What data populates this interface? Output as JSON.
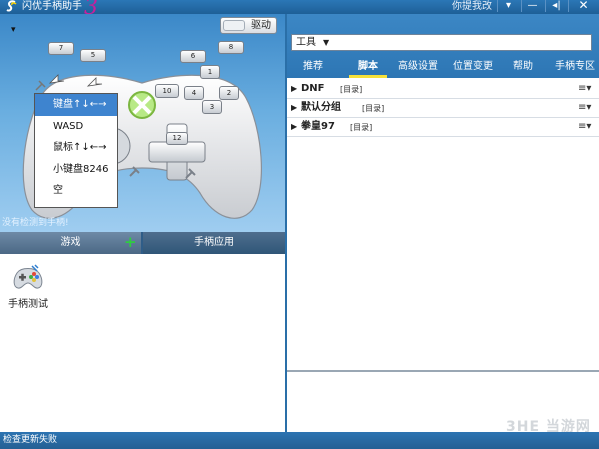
{
  "window": {
    "title": "闪优手柄助手",
    "version_mark": "3",
    "feedback_link": "你提我改",
    "controls": {
      "menu": "▾",
      "minimize": "—",
      "sound": "◂|",
      "close": "✕"
    }
  },
  "left_panel": {
    "menu_arrow": "▾",
    "drive_button": "驱动",
    "status_message": "没有检测到手柄!",
    "button_labels": [
      "7",
      "5",
      "6",
      "8",
      "1",
      "4",
      "2",
      "3",
      "10",
      "12"
    ],
    "key_mode_menu": {
      "selected": "键盘↑↓←→",
      "options": [
        "键盘↑↓←→",
        "WASD",
        "鼠标↑↓←→",
        "小键盘8246",
        "空"
      ]
    },
    "tabs": [
      {
        "label": "游戏",
        "plus": "+"
      },
      {
        "label": "手柄应用"
      }
    ],
    "apps": [
      {
        "label": "手柄测试",
        "icon": "gamepad-test-icon"
      }
    ]
  },
  "right_panel": {
    "tools_label": "工具",
    "tools_dropdown": "▼",
    "nav": [
      {
        "label": "推荐",
        "active": false
      },
      {
        "label": "脚本",
        "active": true
      },
      {
        "label": "高级设置",
        "active": false
      },
      {
        "label": "位置变更",
        "active": false
      },
      {
        "label": "帮助",
        "active": false
      },
      {
        "label": "手柄专区",
        "active": false
      }
    ],
    "scripts": [
      {
        "name": "DNF",
        "tag": "[目录]",
        "menu": "≡▾"
      },
      {
        "name": "默认分组",
        "tag": "[目录]",
        "menu": "≡▾"
      },
      {
        "name": "拳皇97",
        "tag": "[目录]",
        "menu": "≡▾"
      }
    ]
  },
  "status_bar": {
    "text": "检查更新失败"
  },
  "watermark": "3HE 当游网",
  "colors": {
    "chrome_blue": "#2b77b6",
    "accent_yellow": "#f6e13a",
    "selected_item": "#3e84cf",
    "plus_green": "#2ecc40"
  }
}
